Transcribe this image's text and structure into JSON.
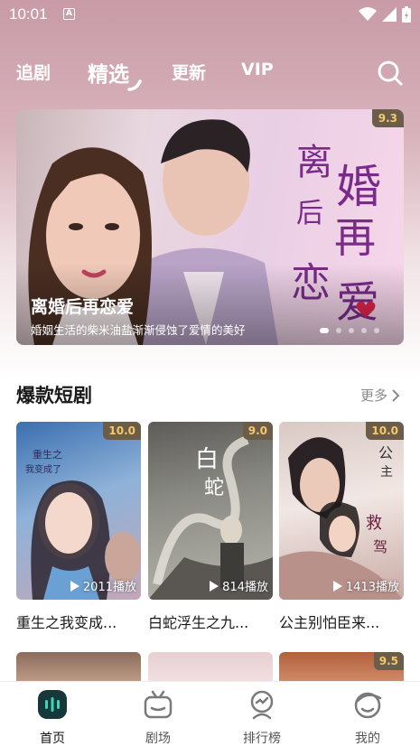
{
  "status": {
    "time": "10:01"
  },
  "nav": {
    "tabs": [
      "追剧",
      "精选",
      "更新",
      "VIP"
    ],
    "active": "精选"
  },
  "banner": {
    "title": "离婚后再恋爱",
    "description": "婚姻生活的柴米油盐渐渐侵蚀了爱情的美好",
    "score": "9.3",
    "art_title": [
      "离",
      "婚",
      "后",
      "再",
      "恋",
      "爱"
    ]
  },
  "section": {
    "title": "爆款短剧",
    "more": "更多"
  },
  "cards": [
    {
      "title": "重生之我变成...",
      "score": "10.0",
      "plays": "2011播放"
    },
    {
      "title": "白蛇浮生之九...",
      "score": "9.0",
      "plays": "814播放"
    },
    {
      "title": "公主别怕臣来...",
      "score": "10.0",
      "plays": "1413播放"
    }
  ],
  "row2": [
    {
      "score": ""
    },
    {
      "score": ""
    },
    {
      "score": "9.5"
    }
  ],
  "tabbar": [
    {
      "label": "首页",
      "icon": "home-icon"
    },
    {
      "label": "剧场",
      "icon": "tv-icon"
    },
    {
      "label": "排行榜",
      "icon": "trophy-icon"
    },
    {
      "label": "我的",
      "icon": "profile-icon"
    }
  ],
  "colors": {
    "accent": "#1f8a7a",
    "score_bg": "#6b5d4a",
    "score_text": "#f4c96a",
    "header_gradient_top": "#c89ba6"
  }
}
